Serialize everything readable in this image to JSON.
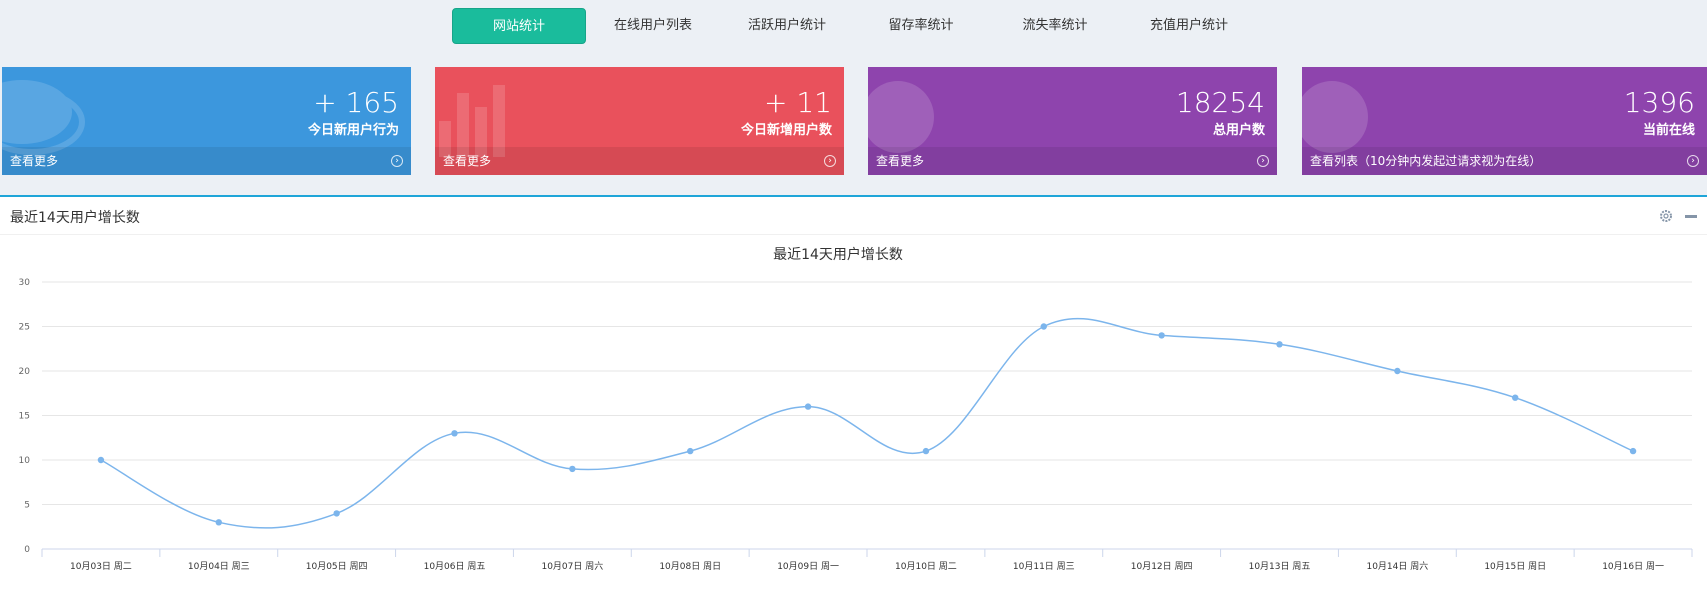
{
  "tabs": [
    {
      "label": "网站统计",
      "active": true
    },
    {
      "label": "在线用户列表"
    },
    {
      "label": "活跃用户统计"
    },
    {
      "label": "留存率统计"
    },
    {
      "label": "流失率统计"
    },
    {
      "label": "充值用户统计"
    }
  ],
  "stats": [
    {
      "value": "+ 165",
      "label": "今日新用户行为",
      "footer": "查看更多",
      "color": "#3c97dd",
      "icon": "chat-bubble-icon"
    },
    {
      "value": "+ 11",
      "label": "今日新增用户数",
      "footer": "查看更多",
      "color": "#e9515c",
      "icon": "bar-chart-icon"
    },
    {
      "value": "18254",
      "label": "总用户数",
      "footer": "查看更多",
      "color": "#8e44ad",
      "icon": "globe-icon"
    },
    {
      "value": "1396",
      "label": "当前在线",
      "footer": "查看列表（10分钟内发起过请求视为在线）",
      "color": "#8e44ad",
      "icon": "globe-icon"
    }
  ],
  "panel": {
    "title": "最近14天用户增长数"
  },
  "chart_data": {
    "type": "line",
    "title": "最近14天用户增长数",
    "categories": [
      "10月03日 周二",
      "10月04日 周三",
      "10月05日 周四",
      "10月06日 周五",
      "10月07日 周六",
      "10月08日 周日",
      "10月09日 周一",
      "10月10日 周二",
      "10月11日 周三",
      "10月12日 周四",
      "10月13日 周五",
      "10月14日 周六",
      "10月15日 周日",
      "10月16日 周一"
    ],
    "values": [
      10,
      3,
      4,
      13,
      9,
      11,
      16,
      11,
      25,
      24,
      23,
      20,
      17,
      11
    ],
    "ylim": [
      0,
      30
    ],
    "yticks": [
      0,
      5,
      10,
      15,
      20,
      25,
      30
    ],
    "color": "#7cb5ec",
    "grid": true,
    "smooth": true
  }
}
